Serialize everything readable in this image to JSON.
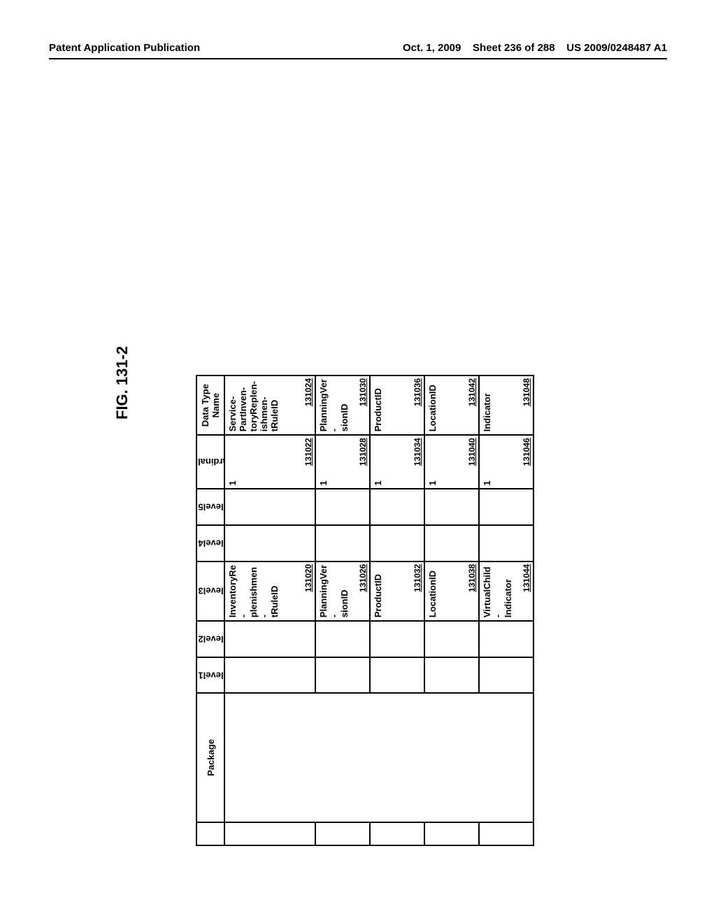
{
  "header": {
    "left": "Patent Application Publication",
    "date": "Oct. 1, 2009",
    "sheet": "Sheet 236 of 288",
    "pubno": "US 2009/0248487 A1"
  },
  "figure_label": "FIG. 131-2",
  "columns": {
    "blank": "",
    "package": "Package",
    "level1": "level1",
    "level2": "level2",
    "level3": "level3",
    "level4": "level4",
    "level5": "level5",
    "cardinality": "Cardinality",
    "datatype": "Data Type Name"
  },
  "rows": [
    {
      "level3": {
        "text": "InventoryRe-\nplenishmen-\ntRuleID",
        "ref": "131020"
      },
      "cardinality": {
        "text": "1",
        "ref": "131022"
      },
      "datatype": {
        "text": "Service-\nPartInven-\ntoryReplen-\nishmen-\ntRuleID",
        "ref": "131024"
      }
    },
    {
      "level3": {
        "text": "PlanningVer-\nsionID",
        "ref": "131026"
      },
      "cardinality": {
        "text": "1",
        "ref": "131028"
      },
      "datatype": {
        "text": "PlanningVer-\nsionID",
        "ref": "131030"
      }
    },
    {
      "level3": {
        "text": "ProductID",
        "ref": "131032"
      },
      "cardinality": {
        "text": "1",
        "ref": "131034"
      },
      "datatype": {
        "text": "ProductID",
        "ref": "131036"
      }
    },
    {
      "level3": {
        "text": "LocationID",
        "ref": "131038"
      },
      "cardinality": {
        "text": "1",
        "ref": "131040"
      },
      "datatype": {
        "text": "LocationID",
        "ref": "131042"
      }
    },
    {
      "level3": {
        "text": "VirtualChild-\nIndicator",
        "ref": "131044"
      },
      "cardinality": {
        "text": "1",
        "ref": "131046"
      },
      "datatype": {
        "text": "Indicator",
        "ref": "131048"
      }
    }
  ]
}
